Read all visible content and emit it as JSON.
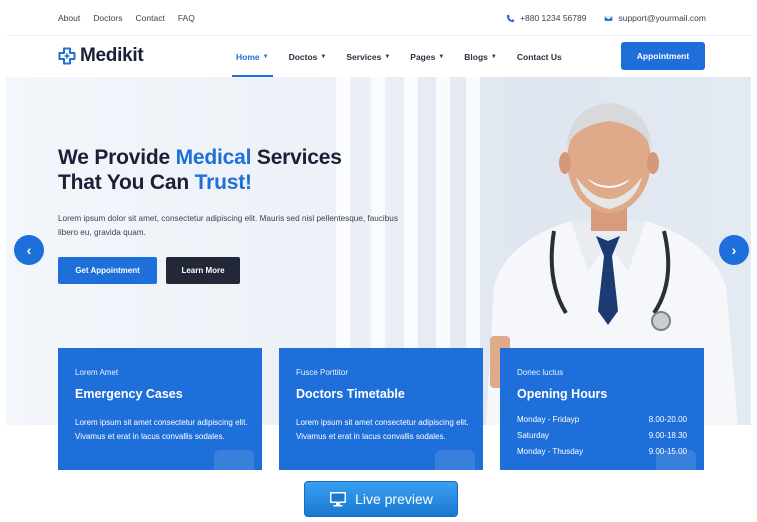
{
  "topbar": {
    "links": [
      "About",
      "Doctors",
      "Contact",
      "FAQ"
    ],
    "phone": "+880 1234 56789",
    "email": "support@yourmail.com"
  },
  "nav": {
    "brand": "Medikit",
    "items": [
      {
        "label": "Home",
        "active": true
      },
      {
        "label": "Doctos",
        "active": false
      },
      {
        "label": "Services",
        "active": false
      },
      {
        "label": "Pages",
        "active": false
      },
      {
        "label": "Blogs",
        "active": false
      },
      {
        "label": "Contact Us",
        "active": false
      }
    ],
    "cta": "Appointment"
  },
  "hero": {
    "headline_1a": "We Provide ",
    "headline_1b": "Medical",
    "headline_1c": " Services",
    "headline_2a": "That You Can ",
    "headline_2b": "Trust!",
    "text": "Lorem ipsum dolor sit amet, consectetur adipiscing elit. Mauris sed nisl pellentesque, faucibus libero eu, gravida quam.",
    "btn_primary": "Get Appointment",
    "btn_secondary": "Learn More"
  },
  "cards": [
    {
      "kicker": "Lorem Amet",
      "title": "Emergency Cases",
      "body": "Lorem ipsum sit amet consectetur adipiscing elit. Vivamus et erat in lacus convallis sodales."
    },
    {
      "kicker": "Fusce Porttitor",
      "title": "Doctors Timetable",
      "body": "Lorem ipsum sit amet consectetur adipiscing elit. Vivamus et erat in lacus convallis sodales."
    },
    {
      "kicker": "Donec luctus",
      "title": "Opening Hours",
      "hours": [
        {
          "day": "Monday - Fridayp",
          "time": "8.00-20.00"
        },
        {
          "day": "Saturday",
          "time": "9.00-18.30"
        },
        {
          "day": "Monday - Thusday",
          "time": "9.00-15.00"
        }
      ]
    }
  ],
  "preview": {
    "label": "Live preview"
  },
  "colors": {
    "accent": "#1e6fd9",
    "dark": "#232838"
  }
}
